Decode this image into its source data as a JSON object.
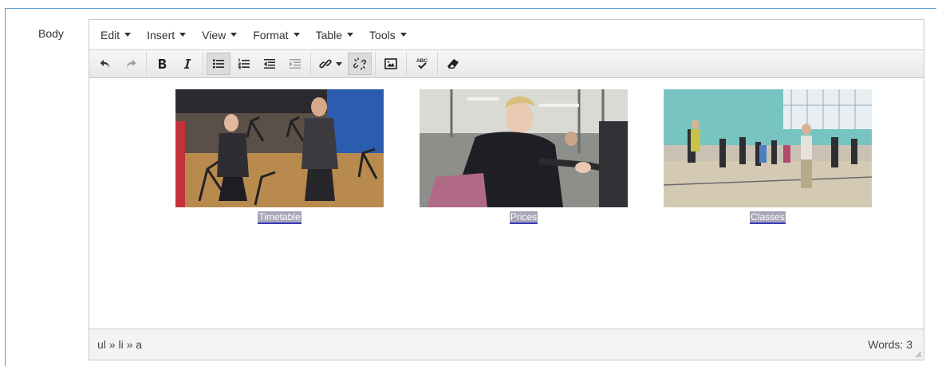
{
  "field": {
    "label": "Body"
  },
  "menubar": {
    "items": [
      {
        "label": "Edit"
      },
      {
        "label": "Insert"
      },
      {
        "label": "View"
      },
      {
        "label": "Format"
      },
      {
        "label": "Table"
      },
      {
        "label": "Tools"
      }
    ]
  },
  "toolbar": {
    "icons": [
      "undo-icon",
      "redo-icon",
      "bold-icon",
      "italic-icon",
      "bullet-list-icon",
      "numbered-list-icon",
      "outdent-icon",
      "indent-icon",
      "link-icon",
      "unlink-icon",
      "image-icon",
      "spellcheck-icon",
      "clear-format-icon"
    ],
    "spellcheck_glyph": "ABC"
  },
  "content": {
    "figures": [
      {
        "caption": "Timetable"
      },
      {
        "caption": "Prices"
      },
      {
        "caption": "Classes"
      }
    ]
  },
  "statusbar": {
    "path": "ul » li » a",
    "word_count": "Words: 3"
  },
  "colors": {
    "frame_border": "#5b9bd5",
    "caption_bg": "#a6a6b8",
    "caption_underline": "#3a3ab8"
  }
}
